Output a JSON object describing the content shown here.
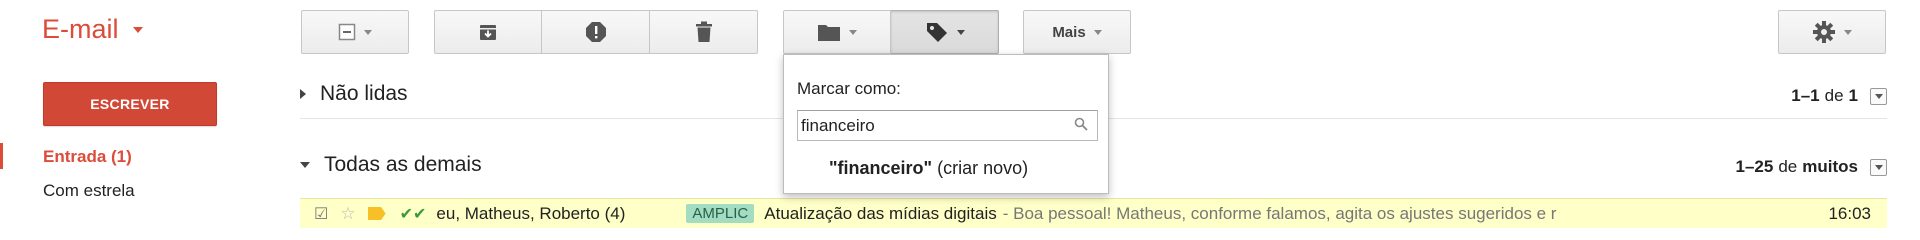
{
  "app": {
    "brand_label": "E-mail",
    "accent_color": "#dd4b39"
  },
  "toolbar": {
    "select_icon": "checkbox-minus-icon",
    "archive_icon": "archive-icon",
    "spam_icon": "report-spam-icon",
    "delete_icon": "trash-icon",
    "move_icon": "folder-icon",
    "labels_icon": "tag-icon",
    "more_label": "Mais",
    "settings_icon": "gear-icon"
  },
  "sidebar": {
    "compose_label": "ESCREVER",
    "compose_color": "#d14836",
    "items": [
      {
        "label": "Entrada (1)",
        "active": true
      },
      {
        "label": "Com estrela",
        "active": false
      }
    ]
  },
  "sections": [
    {
      "title": "Não lidas",
      "expanded": false,
      "range": "1–1",
      "of_label": "de",
      "total": "1"
    },
    {
      "title": "Todas as demais",
      "expanded": true,
      "range": "1–25",
      "of_label": "de",
      "total": "muitos"
    }
  ],
  "email_row": {
    "sender": "eu, Matheus, Roberto (4)",
    "label_chip": "AMPLIC",
    "subject": "Atualização das mídias digitais",
    "snippet": "- Boa pessoal! Matheus, conforme falamos, agita os ajustes sugeridos e r",
    "time": "16:03",
    "row_color": "#ffffc8"
  },
  "label_popup": {
    "title": "Marcar como:",
    "input_value": "financeiro",
    "option_quoted": "\"financeiro\"",
    "option_suffix": "(criar novo)"
  }
}
